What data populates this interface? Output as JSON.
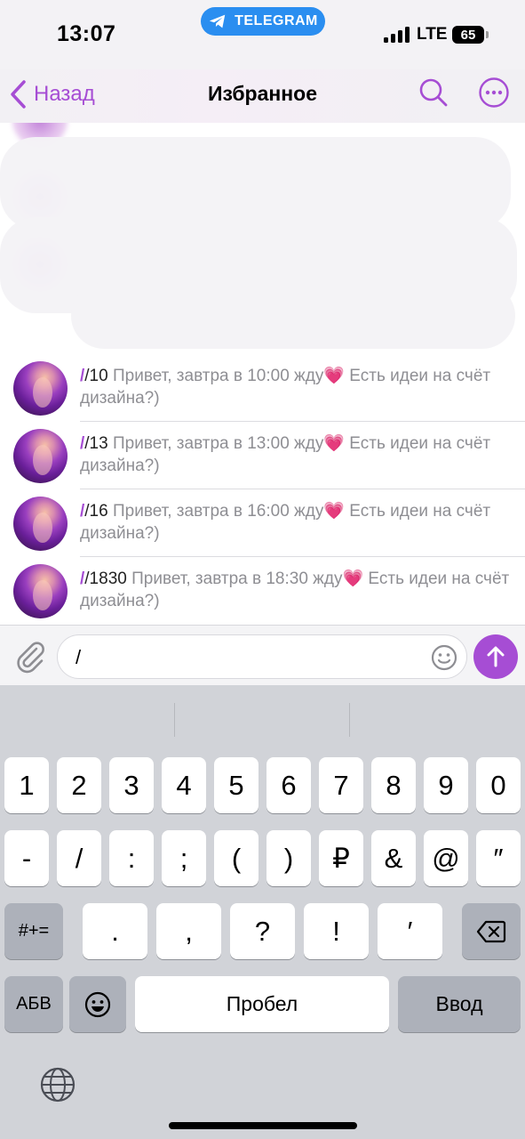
{
  "status_bar": {
    "time": "13:07",
    "app_pill": "TELEGRAM",
    "network": "LTE",
    "battery": "65"
  },
  "nav": {
    "back_label": "Назад",
    "title": "Избранное"
  },
  "suggestions": [
    {
      "command": "/10",
      "text": " Привет, завтра в 10:00 жду",
      "emoji": "💗",
      "text2": " Есть идеи на счёт дизайна?)"
    },
    {
      "command": "/13",
      "text": " Привет, завтра в 13:00 жду",
      "emoji": "💗",
      "text2": " Есть идеи на счёт дизайна?)"
    },
    {
      "command": "/16",
      "text": " Привет, завтра в 16:00 жду",
      "emoji": "💗",
      "text2": " Есть идеи на счёт дизайна?)"
    },
    {
      "command": "/1830",
      "text": " Привет, завтра в 18:30 жду",
      "emoji": "💗",
      "text2": " Есть идеи на счёт дизайна?)"
    }
  ],
  "input": {
    "value": "/"
  },
  "keyboard": {
    "row1": [
      "1",
      "2",
      "3",
      "4",
      "5",
      "6",
      "7",
      "8",
      "9",
      "0"
    ],
    "row2": [
      "-",
      "/",
      ":",
      ";",
      "(",
      ")",
      "₽",
      "&",
      "@",
      "″"
    ],
    "row3_mode": "#+=",
    "row3": [
      ".",
      ",",
      "?",
      "!",
      "′"
    ],
    "row4": {
      "lang": "АБВ",
      "space": "Пробел",
      "return": "Ввод"
    }
  },
  "colors": {
    "accent": "#a64dd4",
    "telegram_blue": "#2a8ef0",
    "keyboard_bg": "#d1d3d8"
  },
  "icons": [
    "chevron-left-icon",
    "search-icon",
    "more-icon",
    "paperclip-icon",
    "emoji-icon",
    "send-arrow-icon",
    "backspace-icon",
    "globe-icon",
    "telegram-plane-icon"
  ]
}
